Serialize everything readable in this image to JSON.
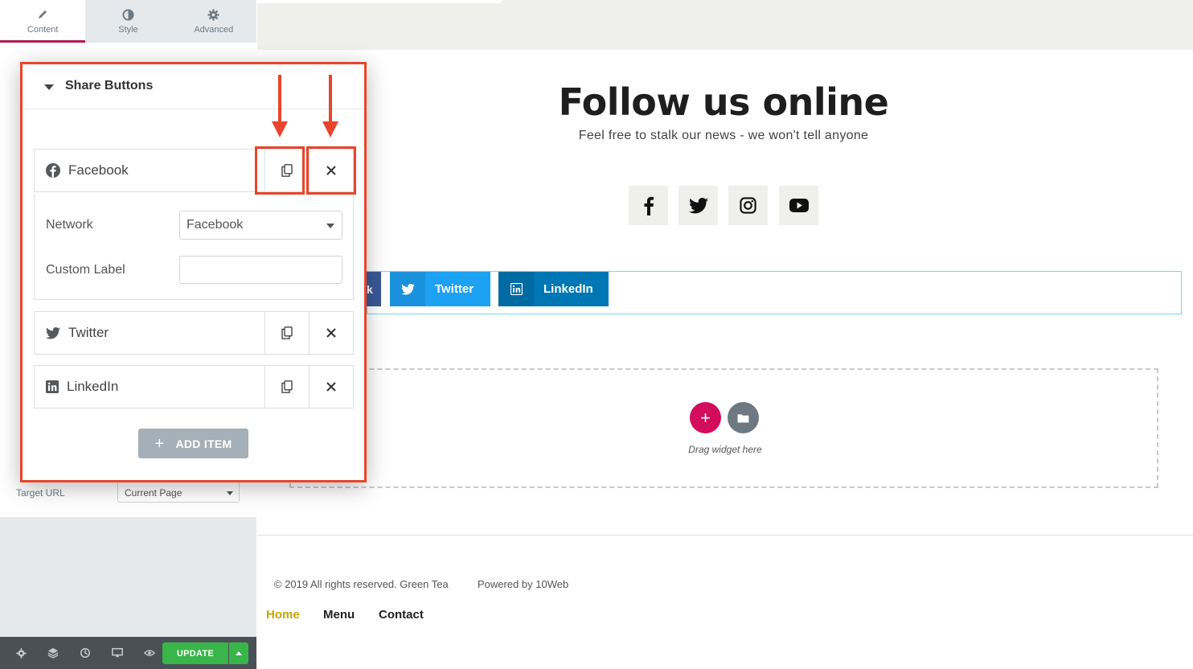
{
  "editor": {
    "tabs": [
      {
        "label": "Content",
        "icon": "pencil-icon"
      },
      {
        "label": "Style",
        "icon": "half-circle-icon"
      },
      {
        "label": "Advanced",
        "icon": "gear-icon"
      }
    ],
    "target_url_label": "Target URL",
    "target_url_value": "Current Page",
    "update_label": "UPDATE"
  },
  "popup": {
    "title": "Share Buttons",
    "items": [
      {
        "label": "Facebook",
        "icon": "facebook-icon"
      },
      {
        "label": "Twitter",
        "icon": "twitter-icon"
      },
      {
        "label": "LinkedIn",
        "icon": "linkedin-icon"
      }
    ],
    "network_label": "Network",
    "network_value": "Facebook",
    "custom_label_label": "Custom Label",
    "custom_label_value": "",
    "add_item_label": "ADD ITEM"
  },
  "preview": {
    "title": "Follow us online",
    "subtitle": "Feel free to stalk our news - we won't tell anyone",
    "social_icons": [
      "facebook-icon",
      "twitter-icon",
      "instagram-icon",
      "youtube-icon"
    ],
    "share_buttons": [
      {
        "label": "Twitter",
        "color": "#1da1f2",
        "icon_bg": "#1a91da"
      },
      {
        "label": "LinkedIn",
        "color": "#0077b5",
        "icon_bg": "#006ba3"
      }
    ],
    "drag_text": "Drag widget here",
    "copyright": "© 2019 All rights reserved. Green Tea",
    "powered": "Powered by 10Web",
    "nav": [
      "Home",
      "Menu",
      "Contact"
    ]
  },
  "colors": {
    "accent_red": "#e8452c",
    "update_green": "#39b54a",
    "add_pink": "#d30c5c",
    "active_nav": "#c9a400"
  }
}
